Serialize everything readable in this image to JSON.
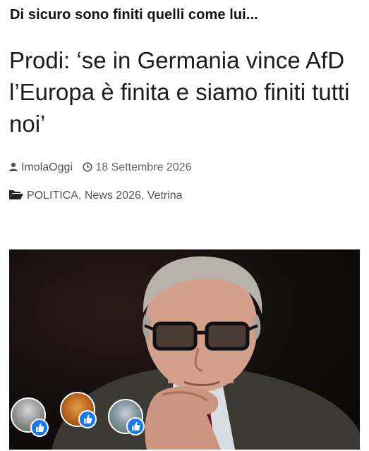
{
  "caption": "Di sicuro sono finiti quelli come lui...",
  "headline": "Prodi: ‘se in Germania vince AfD l’Europa è finita e siamo finiti tutti noi’",
  "meta": {
    "author": "ImolaOggi",
    "date": "18 Settembre 2026",
    "categories": [
      "POLITICA",
      "News 2026",
      "Vetrina"
    ],
    "separator": ","
  },
  "reactions": {
    "like_icon": "thumbs-up-icon",
    "avatars": [
      "avatar-statue",
      "avatar-lion",
      "avatar-bronze-statue"
    ]
  },
  "colors": {
    "accent_like": "#1877f2",
    "meta_text": "#666666"
  }
}
